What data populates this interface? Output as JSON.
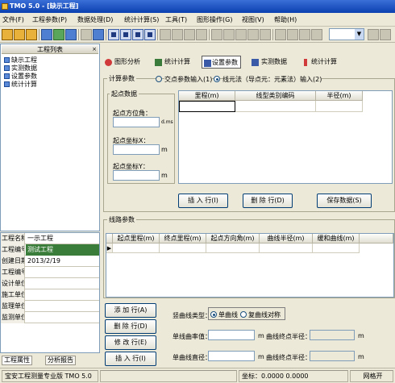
{
  "window": {
    "title": "TMO 5.0 - [缺示工程]"
  },
  "menu": [
    "文件(F)",
    "工程参数(P)",
    "数据处理(D)",
    "统计计算(S)",
    "工具(T)",
    "图形操作(G)",
    "视图(V)",
    "帮助(H)"
  ],
  "tree": {
    "header": "工程列表",
    "close_glyph": "×",
    "items": [
      "缺示工程",
      "实测数据",
      "设置参数",
      "统计计算"
    ]
  },
  "properties": {
    "rows": [
      {
        "key": "工程名称:",
        "value": "一示工程",
        "highlight": false
      },
      {
        "key": "工程编号:",
        "value": "测试工程",
        "highlight": true
      },
      {
        "key": "创建日期:",
        "value": "2013/2/19",
        "highlight": false
      },
      {
        "key": "工程编号:",
        "value": "",
        "highlight": false
      },
      {
        "key": "设计单位:",
        "value": "",
        "highlight": false
      },
      {
        "key": "施工单位:",
        "value": "",
        "highlight": false
      },
      {
        "key": "监理单位:",
        "value": "",
        "highlight": false
      },
      {
        "key": "监测单位:",
        "value": "",
        "highlight": false
      }
    ]
  },
  "left_tabs": [
    "工程属性",
    "分析报告"
  ],
  "main_tabs": [
    {
      "label": "图形分析",
      "active": false,
      "color": "#d03a3a"
    },
    {
      "label": "统计计算",
      "active": false,
      "color": "#3a7a3a"
    },
    {
      "label": "设置参数",
      "active": true,
      "color": "#3a5aa8"
    },
    {
      "label": "实测数据",
      "active": false,
      "color": "#3a5aa8"
    },
    {
      "label": "统计计算",
      "active": false,
      "color": "#d03a3a"
    }
  ],
  "section1": {
    "legend": "计算参数",
    "radio_a": "交点参数输入(1)",
    "radio_b": "线元法（导点元：元素法）输入(2)",
    "start_group": "起点数据",
    "start_mileage_label": "起点方位角：",
    "start_mileage_unit": "d.ms",
    "north_label": "起点坐标X：",
    "north_unit": "m",
    "east_label": "起点坐标Y：",
    "east_unit": "m",
    "table_headers": [
      "里程(m)",
      "线型类别编码",
      "半径(m)"
    ],
    "buttons": {
      "insert": "插 入 行(I)",
      "delete": "删 除 行(D)",
      "save": "保存数据(S)"
    }
  },
  "section2": {
    "legend": "线路参数",
    "table_headers": [
      "起点里程(m)",
      "终点里程(m)",
      "起点方向角(m)",
      "曲线半径(m)",
      "缓和曲线(m)"
    ],
    "buttons": {
      "add": "添 加 行(A)",
      "delete": "删 除 行(D)",
      "edit": "修 改 行(E)",
      "insert": "插 入 行(I)"
    },
    "type_label": "竖曲线类型：",
    "type_a": "单曲线",
    "type_b": "复曲线对称",
    "field1_label": "单线曲率值：",
    "field2_label": "曲线终点半径：",
    "field3_label": "单曲线直径：",
    "field4_label": "曲线终点半径：",
    "unit_m": "m"
  },
  "status": {
    "pane1": "宝安工程测量专业版 TMO 5.0",
    "coords": "坐标：0.0000 0.0000",
    "mode": "网格开"
  }
}
